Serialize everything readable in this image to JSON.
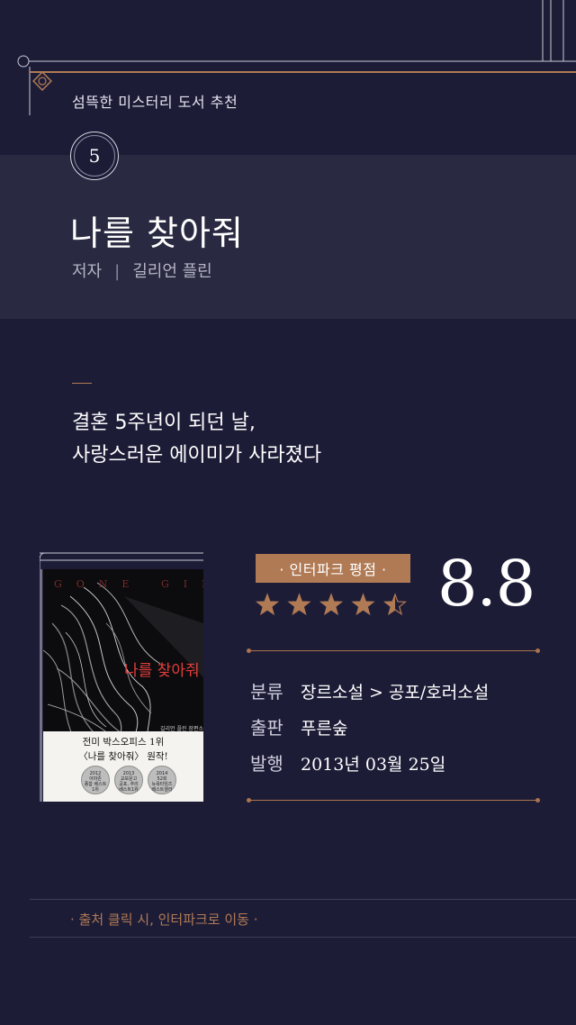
{
  "header": {
    "series_title": "섬뜩한 미스터리 도서 추천"
  },
  "book": {
    "number": "5",
    "title": "나를 찾아줘",
    "author_label": "저자",
    "author_name": "길리언 플린",
    "tagline": [
      "결혼 5주년이 되던 날,",
      "사랑스러운 에이미가 사라졌다"
    ],
    "cover": {
      "english_title": "GONE GIRL",
      "korean_title": "나를 찾아줘",
      "credit": "길리언 플린 장편소설 · 강선재 옮김",
      "blurb": [
        "전미 박스오피스 1위",
        "〈나를 찾아줘〉 원작!"
      ],
      "medals": [
        [
          "2012",
          "아마존",
          "종합 베스트",
          "1위"
        ],
        [
          "2013",
          "교보문고",
          "공포, 추리",
          "베스트1위"
        ],
        [
          "2014",
          "52회",
          "뉴욕타임즈",
          "베스트셀러"
        ]
      ]
    }
  },
  "rating": {
    "label": "· 인터파크 평점 ·",
    "score": "8.8",
    "stars": 4.5,
    "star_color": "#b07a55"
  },
  "details": [
    {
      "key": "분류",
      "value": "장르소설 > 공포/호러소설"
    },
    {
      "key": "출판",
      "value": "푸른숲"
    },
    {
      "key": "발행",
      "value": "2013년 03월 25일"
    }
  ],
  "footer": {
    "link_text": "· 출처 클릭 시, 인터파크로 이동 ·"
  },
  "colors": {
    "background": "#1d1c37",
    "band": "#292941",
    "accent": "#b07a55"
  }
}
